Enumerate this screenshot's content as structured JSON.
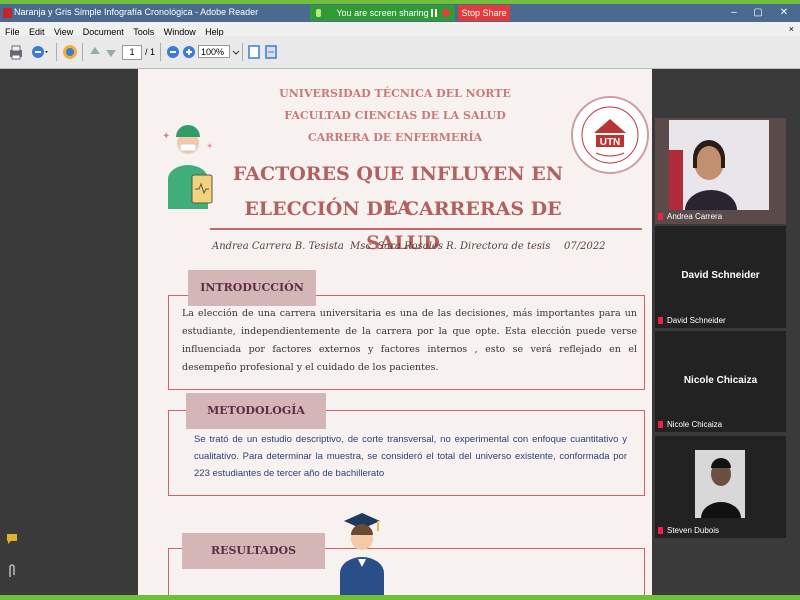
{
  "window": {
    "title": "Naranja y Gris Simple Infografía Cronológica - Adobe Reader",
    "sharing_status": "You are screen sharing",
    "stop_share_label": "Stop Share",
    "controls": [
      "–",
      "▢",
      "✕"
    ]
  },
  "menu": {
    "items": [
      "File",
      "Edit",
      "View",
      "Document",
      "Tools",
      "Window",
      "Help"
    ],
    "close_doc": "×"
  },
  "toolbar": {
    "page_current": "1",
    "page_total": "/ 1",
    "zoom": "100%"
  },
  "document": {
    "university": "UNIVERSIDAD TÉCNICA DEL NORTE",
    "faculty": "FACULTAD CIENCIAS DE LA SALUD",
    "career": "CARRERA DE ENFERMERÍA",
    "title_line1": "FACTORES QUE INFLUYEN  EN LA",
    "title_line2": "ELECCIÓN DE CARRERAS DE SALUD",
    "author": "Andrea Carrera B. Tesista",
    "director": "Msc. Sara Rosales R. Directora de tesis",
    "date": "07/2022",
    "logo_text": "UTN",
    "sections": {
      "intro": {
        "heading": "INTRODUCCIÓN",
        "body": "La elección de una  carrera universitaria es una de las decisiones, más importantes para un estudiante, independientemente de la carrera por la que opte. Esta elección puede verse influenciada por factores externos y factores internos , esto se verá reflejado en el desempeño profesional y el cuidado de los pacientes."
      },
      "method": {
        "heading": "METODOLOGÍA",
        "body": "Se trató de un estudio descriptivo, de corte transversal, no experimental con enfoque cuantitativo y cualitativo. Para determinar la muestra, se consideró el total del universo existente, conformada por 223 estudiantes de tercer año de bachillerato"
      },
      "results": {
        "heading": "RESULTADOS"
      }
    }
  },
  "participants": [
    {
      "name": "Andrea Carrera",
      "has_video": true
    },
    {
      "name": "David Schneider",
      "display": "David Schneider",
      "has_video": false
    },
    {
      "name": "Nicole Chicaiza",
      "display": "Nicole Chicaiza",
      "has_video": false
    },
    {
      "name": "Steven Dubois",
      "has_video": true
    }
  ],
  "colors": {
    "accent_green": "#6fbf3a",
    "heading_rose": "#c87a7a",
    "title_rose": "#b36060",
    "section_tab": "#d4b6b6",
    "method_text": "#2a3f7a"
  }
}
